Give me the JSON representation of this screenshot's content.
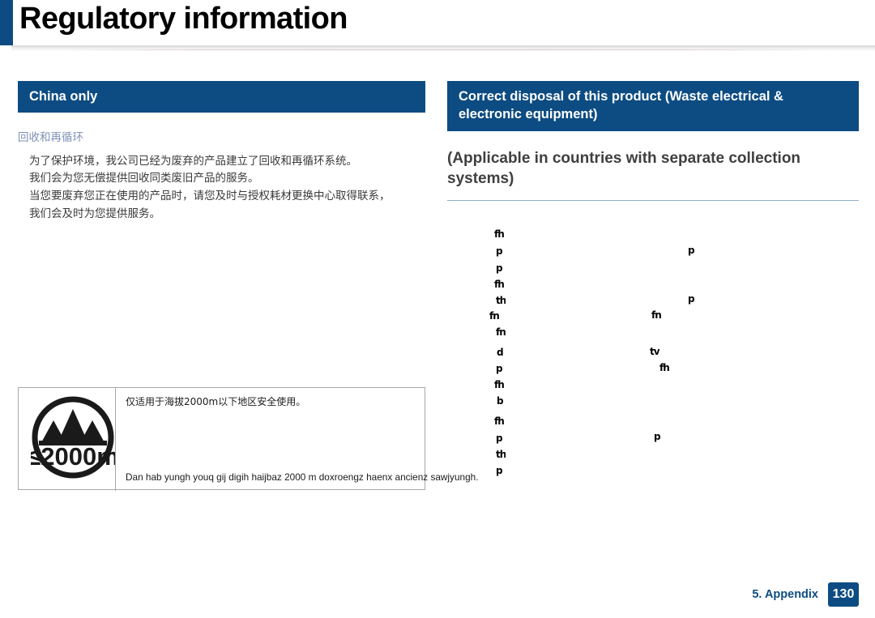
{
  "header": {
    "title": "Regulatory information",
    "accent_color": "#0d4c82"
  },
  "left_column": {
    "section_title": "China only",
    "subheading": "回收和再循环",
    "body_lines": [
      "为了保护环境，我公司已经为废弃的产品建立了回收和再循环系统。",
      "我们会为您无偿提供回收同类废旧产品的服务。",
      "当您要废弃您正在使用的产品时，请您及时与授权耗材更换中心取得联系，",
      "我们会及时为您提供服务。"
    ],
    "altitude_box": {
      "symbol_label": "≤2000m",
      "chinese_note": "仅适用于海拔2000m以下地区安全使用。",
      "zhuang_note": "Dan hab yungh youq gij digih haijbaz 2000 m doxroengz haenx ancienz sawjyungh."
    }
  },
  "right_column": {
    "section_title": "Correct disposal of this product (Waste electrical & electronic equipment)",
    "subheading": "(Applicable in countries with separate collection systems)",
    "body_glyph_fragments_left": [
      "fh",
      "p",
      "p",
      "fh",
      "th",
      "fn",
      "fn",
      "d",
      "p",
      "fh",
      "b",
      "fh",
      "p",
      "th",
      "p"
    ],
    "body_glyph_fragments_right": [
      "p",
      "p",
      "fn",
      "tv",
      "fh",
      "p"
    ]
  },
  "footer": {
    "chapter_label": "5. Appendix",
    "page_number": "130"
  }
}
